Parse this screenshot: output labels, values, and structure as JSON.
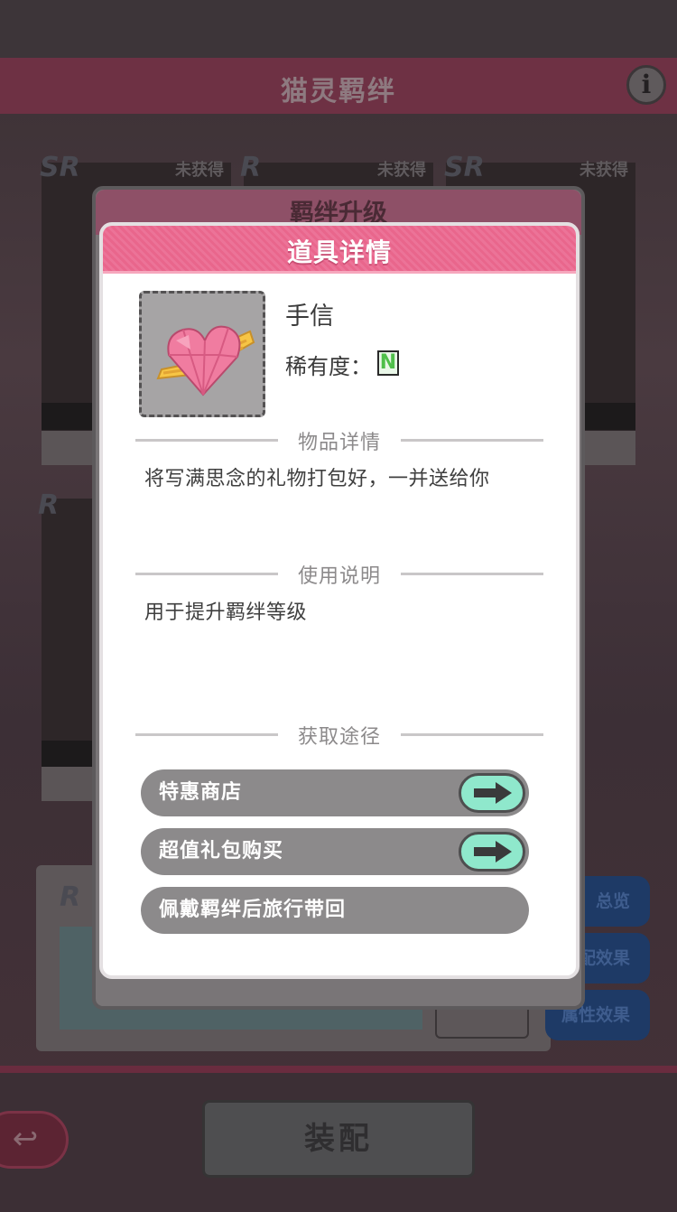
{
  "screen_title": "猫灵羁绊",
  "info_icon": "i",
  "cards": [
    {
      "rarity": "SR",
      "status": "未获得"
    },
    {
      "rarity": "R",
      "status": "未获得"
    },
    {
      "rarity": "SR",
      "status": "未获得"
    },
    {
      "rarity": "R",
      "status": ""
    }
  ],
  "bottom_panel": {
    "rarity": "R"
  },
  "side_buttons": [
    "总览",
    "配效果",
    "属性效果"
  ],
  "equip_button": "装配",
  "back_icon": "↩",
  "underlying_dialog": {
    "title": "羁绊升级"
  },
  "item_detail": {
    "title": "道具详情",
    "item_name": "手信",
    "rarity_label": "稀有度：",
    "rarity_value": "N",
    "sections": {
      "details_header": "物品详情",
      "details_text": "将写满思念的礼物打包好，一并送给你",
      "usage_header": "使用说明",
      "usage_text": "用于提升羁绊等级",
      "source_header": "获取途径"
    },
    "sources": [
      {
        "label": "特惠商店",
        "has_go": true
      },
      {
        "label": "超值礼包购买",
        "has_go": true
      },
      {
        "label": "佩戴羁绊后旅行带回",
        "has_go": false
      }
    ]
  },
  "colors": {
    "accent_pink": "#e9668c",
    "go_button": "#8fe8cc",
    "source_pill": "#8c8a8b"
  }
}
